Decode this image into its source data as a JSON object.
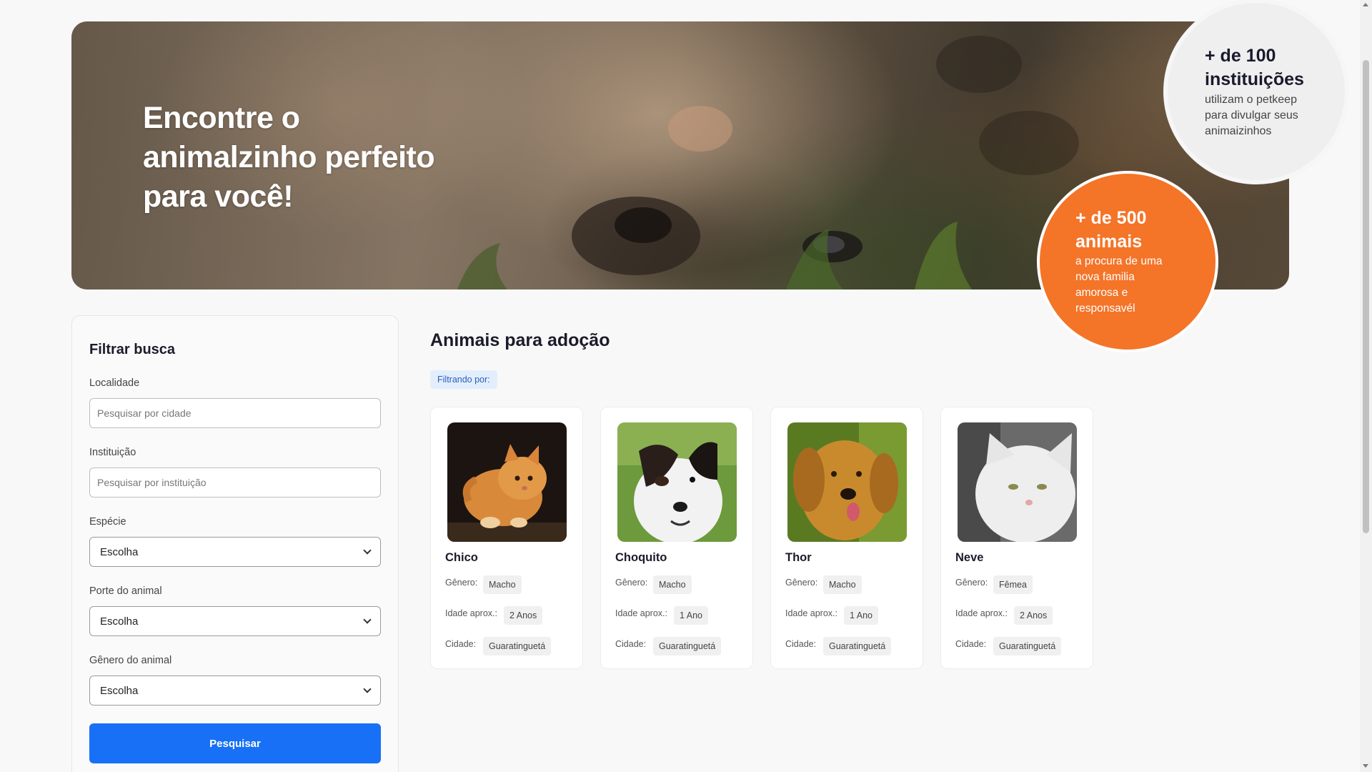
{
  "hero": {
    "title": "Encontre o animalzinho perfeito para você!"
  },
  "stats": {
    "institutions": {
      "number": "+ de 100 instituições",
      "description": "utilizam o petkeep para divulgar seus animaizinhos"
    },
    "animals": {
      "number": "+ de 500 animais",
      "description": "a procura de uma nova familia amorosa e responsavél"
    }
  },
  "filter": {
    "title": "Filtrar busca",
    "location": {
      "label": "Localidade",
      "placeholder": "Pesquisar por cidade"
    },
    "institution": {
      "label": "Instituição",
      "placeholder": "Pesquisar por instituição"
    },
    "species": {
      "label": "Espécie",
      "value": "Escolha"
    },
    "size": {
      "label": "Porte do animal",
      "value": "Escolha"
    },
    "gender": {
      "label": "Gênero do animal",
      "value": "Escolha"
    },
    "search_button": "Pesquisar"
  },
  "main": {
    "title": "Animais para adoção",
    "filter_chip": "Filtrando por:",
    "field_labels": {
      "gender": "Gênero:",
      "age": "Idade aprox.:",
      "city": "Cidade:"
    },
    "animals": [
      {
        "name": "Chico",
        "gender": "Macho",
        "age": "2 Anos",
        "city": "Guaratinguetá",
        "photo": "orange-kitten-photo"
      },
      {
        "name": "Choquito",
        "gender": "Macho",
        "age": "1 Ano",
        "city": "Guaratinguetá",
        "photo": "black-white-dog-photo"
      },
      {
        "name": "Thor",
        "gender": "Macho",
        "age": "1 Ano",
        "city": "Guaratinguetá",
        "photo": "golden-retriever-photo"
      },
      {
        "name": "Neve",
        "gender": "Fêmea",
        "age": "2 Anos",
        "city": "Guaratinguetá",
        "photo": "white-cat-photo"
      }
    ]
  },
  "colors": {
    "accent_orange": "#f47428",
    "primary_blue": "#1770f5",
    "chip_blue": "#e3eefc"
  }
}
